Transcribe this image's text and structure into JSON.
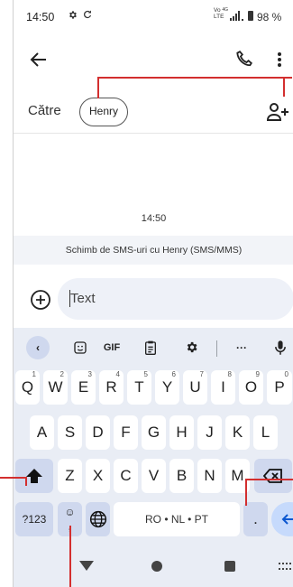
{
  "status_bar": {
    "time": "14:50",
    "network_top": "Vo",
    "network_bottom": "LTE",
    "network_sup": "4G",
    "battery_percent": "98 %"
  },
  "header": {
    "to_label": "Către",
    "recipient_chip": "Henry"
  },
  "conversation": {
    "timestamp": "14:50",
    "info_banner": "Schimb de SMS-uri cu Henry (SMS/MMS)"
  },
  "compose": {
    "placeholder": "Text"
  },
  "keyboard": {
    "toolbar": {
      "back": "‹",
      "gif": "GIF",
      "more": "···"
    },
    "row1": [
      {
        "k": "Q",
        "hint": "1"
      },
      {
        "k": "W",
        "hint": "2"
      },
      {
        "k": "E",
        "hint": "3"
      },
      {
        "k": "R",
        "hint": "4"
      },
      {
        "k": "T",
        "hint": "5"
      },
      {
        "k": "Y",
        "hint": "6"
      },
      {
        "k": "U",
        "hint": "7"
      },
      {
        "k": "I",
        "hint": "8"
      },
      {
        "k": "O",
        "hint": "9"
      },
      {
        "k": "P",
        "hint": "0"
      }
    ],
    "row2": [
      "A",
      "S",
      "D",
      "F",
      "G",
      "H",
      "J",
      "K",
      "L"
    ],
    "row3": [
      "Z",
      "X",
      "C",
      "V",
      "B",
      "N",
      "M"
    ],
    "symbols_key": "?123",
    "comma_key": ",",
    "space_label": "RO • NL • PT",
    "period_key": "."
  }
}
